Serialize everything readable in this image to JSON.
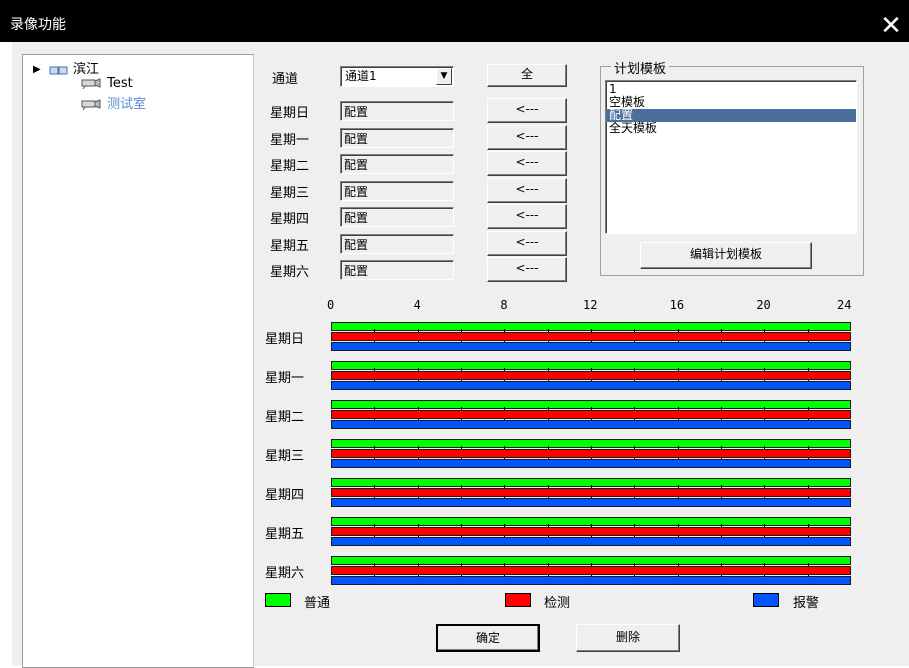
{
  "window": {
    "title": "录像功能"
  },
  "tree": {
    "root": "滨江",
    "children": [
      "Test",
      "测试室"
    ]
  },
  "channel": {
    "label": "通道",
    "value": "通道1",
    "all_button": "全"
  },
  "days": [
    {
      "label": "星期日",
      "value": "配置",
      "button": "<---"
    },
    {
      "label": "星期一",
      "value": "配置",
      "button": "<---"
    },
    {
      "label": "星期二",
      "value": "配置",
      "button": "<---"
    },
    {
      "label": "星期三",
      "value": "配置",
      "button": "<---"
    },
    {
      "label": "星期四",
      "value": "配置",
      "button": "<---"
    },
    {
      "label": "星期五",
      "value": "配置",
      "button": "<---"
    },
    {
      "label": "星期六",
      "value": "配置",
      "button": "<---"
    }
  ],
  "template_panel": {
    "legend": "计划模板",
    "items": [
      "1",
      "空模板",
      "配置",
      "全天模板"
    ],
    "selected_index": 2,
    "edit_button": "编辑计划模板"
  },
  "timeline": {
    "axis": [
      "0",
      "4",
      "8",
      "12",
      "16",
      "20",
      "24"
    ],
    "rows": [
      "星期日",
      "星期一",
      "星期二",
      "星期三",
      "星期四",
      "星期五",
      "星期六"
    ],
    "colors": {
      "normal": "#00ff00",
      "detect": "#ff0000",
      "alarm": "#0055ff"
    }
  },
  "legend": {
    "normal": "普通",
    "detect": "检测",
    "alarm": "报警"
  },
  "footer": {
    "ok": "确定",
    "delete": "删除"
  }
}
